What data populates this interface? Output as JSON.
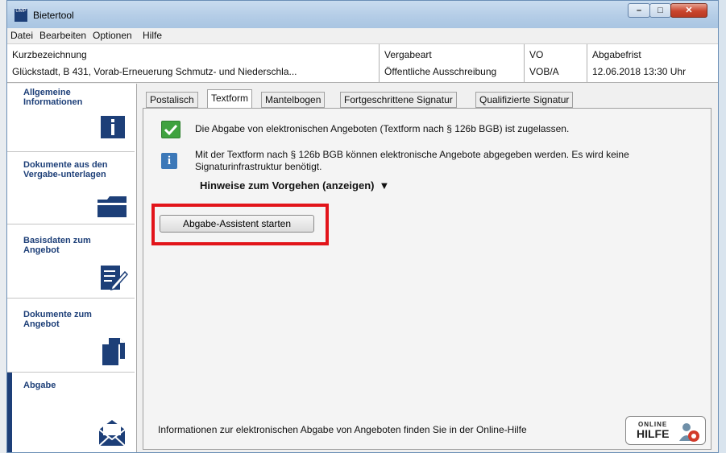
{
  "window": {
    "title": "Bietertool",
    "icon_text": "UMP"
  },
  "menu": [
    "Datei",
    "Bearbeiten",
    "Optionen",
    "Hilfe"
  ],
  "header": {
    "kurzbezeichnung_label": "Kurzbezeichnung",
    "kurzbezeichnung_value": "Glückstadt, B 431, Vorab-Erneuerung Schmutz- und Niederschla...",
    "vergabeart_label": "Vergabeart",
    "vergabeart_value": "Öffentliche Ausschreibung",
    "vo_label": "VO",
    "vo_value": "VOB/A",
    "abgabefrist_label": "Abgabefrist",
    "abgabefrist_value": "12.06.2018 13:30 Uhr"
  },
  "sidebar": {
    "items": [
      {
        "label": "Allgemeine Informationen",
        "icon": "info-icon"
      },
      {
        "label": "Dokumente aus den Vergabe-unterlagen",
        "icon": "folder-icon"
      },
      {
        "label": "Basisdaten zum Angebot",
        "icon": "edit-form-icon"
      },
      {
        "label": "Dokumente zum Angebot",
        "icon": "documents-icon"
      },
      {
        "label": "Abgabe",
        "icon": "envelope-icon",
        "selected": true
      }
    ]
  },
  "tabs": [
    "Postalisch",
    "Textform",
    "Mantelbogen",
    "Fortgeschrittene Signatur",
    "Qualifizierte Signatur"
  ],
  "active_tab": "Textform",
  "panel": {
    "allowed_message": "Die Abgabe von elektronischen Angeboten (Textform nach § 126b BGB) ist zugelassen.",
    "info_message": "Mit der Textform nach § 126b BGB können elektronische Angebote abgegeben werden. Es wird keine Signaturinfrastruktur benötigt.",
    "hint_link": "Hinweise zum Vorgehen (anzeigen)",
    "start_button": "Abgabe-Assistent starten",
    "footer_text": "Informationen zur elektronischen Abgabe von Angeboten finden Sie in der Online-Hilfe",
    "online_help_top": "ONLINE",
    "online_help_main": "HILFE"
  },
  "colors": {
    "accent": "#1d3f78",
    "highlight": "#e2141a",
    "check": "#3fa23f",
    "info": "#3c78b8"
  }
}
